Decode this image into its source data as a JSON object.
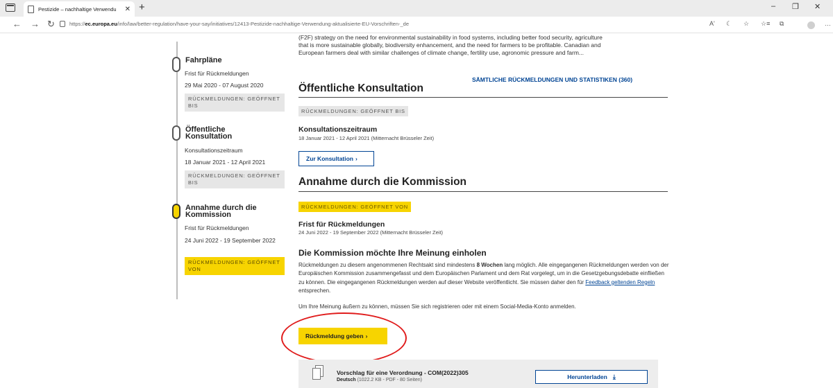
{
  "browser": {
    "tab_title": "Pestizide – nachhaltige Verwendu",
    "tab_close": "✕",
    "new_tab": "+",
    "url_prefix": "https://",
    "url_host": "ec.europa.eu",
    "url_path": "/info/law/better-regulation/have-your-say/initiatives/12413-Pestizide-nachhaltige-Verwendung-aktualisierte-EU-Vorschriften-_de",
    "window_controls": {
      "minimize": "–",
      "restore": "❐",
      "close": "✕"
    },
    "nav": {
      "back": "←",
      "forward": "→",
      "reload": "↻"
    },
    "toolbar_icons": [
      "Aʹ",
      "☾",
      "☆",
      "☆≡",
      "⧉",
      "…"
    ]
  },
  "timeline": [
    {
      "title": "Fahrpläne",
      "label": "Frist für Rückmeldungen",
      "dates": "29 Mai 2020 - 07 August 2020",
      "badge": "RÜCKMELDUNGEN: GEÖFFNET BIS",
      "active": false
    },
    {
      "title": "Öffentliche Konsultation",
      "label": "Konsultationszeitraum",
      "dates": "18 Januar 2021 - 12 April 2021",
      "badge": "RÜCKMELDUNGEN: GEÖFFNET BIS",
      "active": false
    },
    {
      "title": "Annahme durch die Kommission",
      "label": "Frist für Rückmeldungen",
      "dates": "24 Juni 2022 - 19 September 2022",
      "badge": "RÜCKMELDUNGEN: GEÖFFNET VON",
      "active": true
    }
  ],
  "main": {
    "intro": "(F2F) strategy on the need for environmental sustainability in food systems, including better food security, agriculture that is more sustainable globally, biodiversity enhancement, and the need for farmers to be profitable. Canadian and European farmers deal with similar challenges of climate change, fertility use, agronomic pressure and farm...",
    "all_feedback_link": "SÄMTLICHE RÜCKMELDUNGEN UND STATISTIKEN (360)",
    "consultation": {
      "heading": "Öffentliche Konsultation",
      "badge": "RÜCKMELDUNGEN: GEÖFFNET BIS",
      "period_title": "Konsultationszeitraum",
      "period_dates": "18 Januar 2021 - 12 April 2021  (Mitternacht Brüsseler Zeit)",
      "button": "Zur Konsultation"
    },
    "adoption": {
      "heading": "Annahme durch die Kommission",
      "badge": "RÜCKMELDUNGEN: GEÖFFNET VON",
      "deadline_title": "Frist für Rückmeldungen",
      "deadline_dates": "24 Juni 2022 - 19 September 2022  (Mitternacht Brüsseler Zeit)",
      "opinion_heading": "Die Kommission möchte Ihre Meinung einholen",
      "para1_a": "Rückmeldungen zu diesem angenommenen Rechtsakt sind mindestens ",
      "para1_bold": "8 Wochen",
      "para1_b": " lang möglich. Alle eingegangenen Rückmeldungen werden von der Europäischen Kommission zusammengefasst und dem Europäischen Parlament und dem Rat vorgelegt, um in die Gesetzgebungsdebatte einfließen zu können. Die eingegangenen Rückmeldungen werden auf dieser Website veröffentlicht. Sie müssen daher den für ",
      "para1_link": "Feedback geltenden Regeln",
      "para1_c": " entsprechen.",
      "para2": "Um Ihre Meinung äußern zu können, müssen Sie sich registrieren oder mit einem Social-Media-Konto anmelden.",
      "feedback_button": "Rückmeldung geben"
    },
    "document": {
      "title": "Vorschlag für eine Verordnung - COM(2022)305",
      "language": "Deutsch",
      "meta": " (1022.2 KB - PDF - 80 Seiten)",
      "download_button": "Herunterladen"
    }
  },
  "colors": {
    "accent_yellow": "#f7d400",
    "link_blue": "#004494",
    "highlight_red": "#e01b1b"
  }
}
